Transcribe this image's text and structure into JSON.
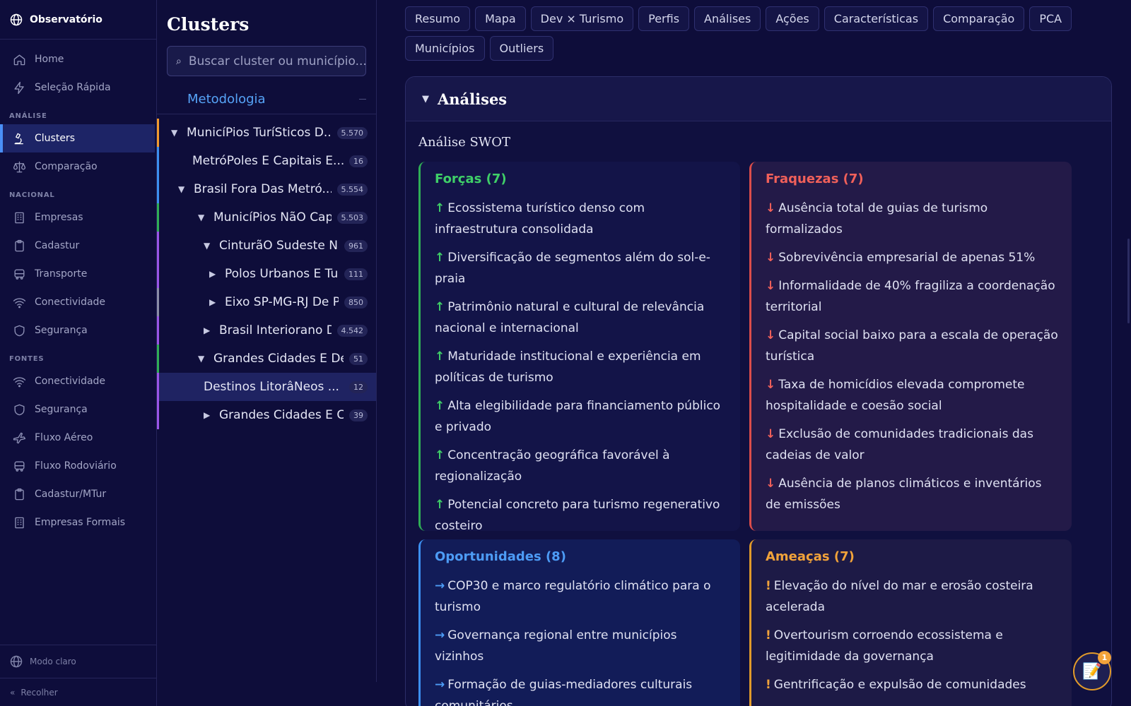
{
  "brand": {
    "name": "Observatório",
    "icon": "globe-icon"
  },
  "nav": {
    "top": [
      {
        "label": "Home",
        "icon": "home-icon"
      },
      {
        "label": "Seleção Rápida",
        "icon": "bolt-icon"
      }
    ],
    "sections": [
      {
        "title": "ANÁLISE",
        "items": [
          {
            "label": "Clusters",
            "icon": "microscope-icon",
            "active": true
          },
          {
            "label": "Comparação",
            "icon": "scale-icon"
          }
        ]
      },
      {
        "title": "NACIONAL",
        "items": [
          {
            "label": "Empresas",
            "icon": "building-icon"
          },
          {
            "label": "Cadastur",
            "icon": "clipboard-icon"
          },
          {
            "label": "Transporte",
            "icon": "bus-icon"
          },
          {
            "label": "Conectividade",
            "icon": "wifi-icon"
          },
          {
            "label": "Segurança",
            "icon": "shield-icon"
          }
        ]
      },
      {
        "title": "FONTES",
        "items": [
          {
            "label": "Conectividade",
            "icon": "wifi-icon"
          },
          {
            "label": "Segurança",
            "icon": "shield-icon"
          },
          {
            "label": "Fluxo Aéreo",
            "icon": "plane-icon"
          },
          {
            "label": "Fluxo Rodoviário",
            "icon": "bus-icon"
          },
          {
            "label": "Cadastur/MTur",
            "icon": "clipboard-icon"
          },
          {
            "label": "Empresas Formais",
            "icon": "building-icon"
          }
        ]
      }
    ],
    "footer": {
      "theme_label": "Modo claro",
      "collapse_label": "Recolher",
      "collapse_glyph": "«"
    }
  },
  "clusters": {
    "title": "Clusters",
    "search_placeholder": "Buscar cluster ou município...",
    "methodology_label": "Metodologia",
    "tree": [
      {
        "label": "MunicíPios TuríSticos D...",
        "count": "5.570",
        "caret": "▼",
        "color": "#f29a2e"
      },
      {
        "label": "MetróPoles E Capitais E...",
        "count": "16",
        "caret": "",
        "color": "#3c8ff0"
      },
      {
        "label": "Brasil Fora Das Metró...",
        "count": "5.554",
        "caret": "▼",
        "color": "#3c8ff0"
      },
      {
        "label": "MunicíPios NãO Capi...",
        "count": "5.503",
        "caret": "▼",
        "color": "#2fae56"
      },
      {
        "label": "CinturãO Sudeste Nã...",
        "count": "961",
        "caret": "▼",
        "color": "#9a55e8"
      },
      {
        "label": "Polos Urbanos E Turí...",
        "count": "111",
        "caret": "▶",
        "color": "#9a55e8"
      },
      {
        "label": "Eixo SP-MG-RJ De Pe...",
        "count": "850",
        "caret": "▶",
        "color": "#8b8da8"
      },
      {
        "label": "Brasil Interiorano D...",
        "count": "4.542",
        "caret": "▶",
        "color": "#9a55e8"
      },
      {
        "label": "Grandes Cidades E Des...",
        "count": "51",
        "caret": "▼",
        "color": "#2fae56"
      },
      {
        "label": "Destinos LitorâNeos ...",
        "count": "12",
        "caret": "",
        "color": "#9a55e8",
        "selected": true
      },
      {
        "label": "Grandes Cidades E Ca...",
        "count": "39",
        "caret": "▶",
        "color": "#9a55e8"
      }
    ]
  },
  "tabs": [
    "Resumo",
    "Mapa",
    "Dev × Turismo",
    "Perfis",
    "Análises",
    "Ações",
    "Características",
    "Comparação",
    "PCA",
    "Municípios",
    "Outliers"
  ],
  "section": {
    "title": "Análises",
    "toggle_glyph": "▼",
    "swot_heading": "Análise SWOT",
    "forcas": {
      "title": "Forças (7)",
      "marker": "↑",
      "items": [
        "Ecossistema turístico denso com infraestrutura consolidada",
        "Diversificação de segmentos além do sol-e-praia",
        "Patrimônio natural e cultural de relevância nacional e internacional",
        "Maturidade institucional e experiência em políticas de turismo",
        "Alta elegibilidade para financiamento público e privado",
        "Concentração geográfica favorável à regionalização",
        "Potencial concreto para turismo regenerativo costeiro"
      ]
    },
    "fraquezas": {
      "title": "Fraquezas (7)",
      "marker": "↓",
      "items": [
        "Ausência total de guias de turismo formalizados",
        "Sobrevivência empresarial de apenas 51%",
        "Informalidade de 40% fragiliza a coordenação territorial",
        "Capital social baixo para a escala de operação turística",
        "Taxa de homicídios elevada compromete hospitalidade e coesão social",
        "Exclusão de comunidades tradicionais das cadeias de valor",
        "Ausência de planos climáticos e inventários de emissões"
      ]
    },
    "oportunidades": {
      "title": "Oportunidades (8)",
      "marker": "→",
      "items": [
        "COP30 e marco regulatório climático para o turismo",
        "Governança regional entre municípios vizinhos",
        "Formação de guias-mediadores culturais comunitários"
      ]
    },
    "ameacas": {
      "title": "Ameaças (7)",
      "marker": "!",
      "items": [
        "Elevação do nível do mar e erosão costeira acelerada",
        "Overtourism corroendo ecossistema e legitimidade da governança",
        "Gentrificação e expulsão de comunidades"
      ]
    }
  },
  "fab": {
    "icon": "notes-icon",
    "glyph": "📝",
    "badge": "1"
  }
}
